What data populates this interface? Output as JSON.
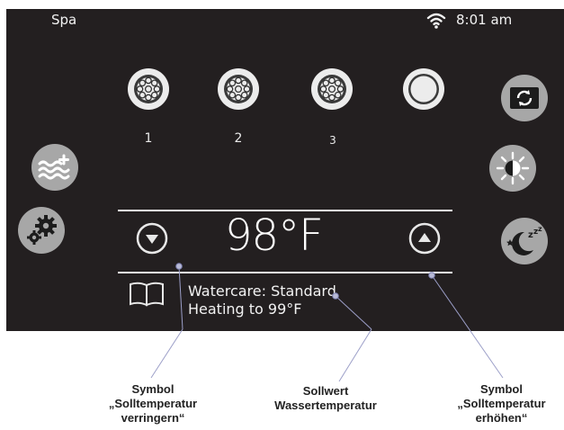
{
  "topbar": {
    "title": "Spa",
    "time": "8:01 am"
  },
  "pumps": [
    {
      "label": "1"
    },
    {
      "label": "2"
    },
    {
      "label": "3"
    }
  ],
  "temperature": {
    "setpoint": "98°F"
  },
  "status": {
    "watercare": "Watercare: Standard",
    "heating": "Heating to 99°F"
  },
  "icons": {
    "wifi": "wifi-icon",
    "jets": "jets-icon",
    "light": "light-ring-icon",
    "water_add": "water-plus-icon",
    "settings": "settings-gears-icon",
    "flip": "flip-screen-icon",
    "brightness": "brightness-icon",
    "sleep": "sleep-mode-icon",
    "manual": "book-icon"
  },
  "callouts": {
    "decrease": {
      "line1": "Symbol",
      "line2": "„Solltemperatur",
      "line3": "verringern“"
    },
    "setpoint": {
      "line1": "Sollwert",
      "line2": "Wassertemperatur"
    },
    "increase": {
      "line1": "Symbol",
      "line2": "„Solltemperatur",
      "line3": "erhöhen“"
    }
  },
  "colors": {
    "screen_bg": "#231f20",
    "button_gray": "#a7a7a7",
    "text_light": "#f2f2f2",
    "callout_line": "#9c9fc8"
  }
}
